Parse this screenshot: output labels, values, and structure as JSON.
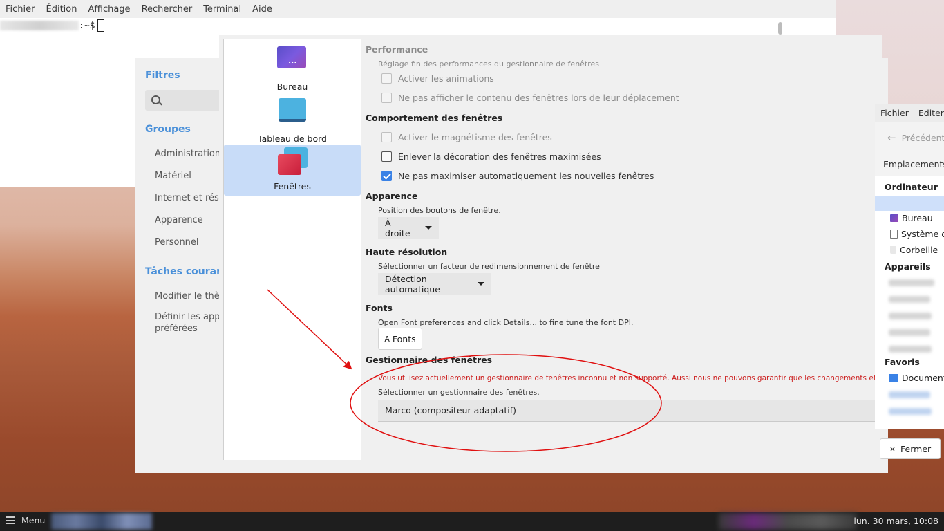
{
  "terminal": {
    "menu": [
      "Fichier",
      "Édition",
      "Affichage",
      "Rechercher",
      "Terminal",
      "Aide"
    ],
    "prompt_suffix": ":~$"
  },
  "control_center": {
    "filters_heading": "Filtres",
    "search_placeholder": "",
    "groups_heading": "Groupes",
    "groups": [
      "Administration",
      "Matériel",
      "Internet et résea",
      "Apparence",
      "Personnel"
    ],
    "tasks_heading": "Tâches courant",
    "tasks": [
      "Modifier le thèm",
      "Définir les applic\npréférées"
    ]
  },
  "appearance": {
    "categories": [
      {
        "label": "Bureau",
        "icon": "desktop-icon"
      },
      {
        "label": "Tableau de bord",
        "icon": "panel-icon"
      },
      {
        "label": "Fenêtres",
        "icon": "windows-icon",
        "selected": true
      }
    ],
    "performance": {
      "heading": "Performance",
      "subtitle": "Réglage fin des performances du gestionnaire de fenêtres",
      "options": [
        {
          "label": "Activer les animations",
          "checked": false,
          "enabled": false
        },
        {
          "label": "Ne pas afficher le contenu des fenêtres lors de leur déplacement",
          "checked": false,
          "enabled": false
        }
      ]
    },
    "behaviour": {
      "heading": "Comportement des fenêtres",
      "options": [
        {
          "label": "Activer le magnétisme des fenêtres",
          "checked": false,
          "enabled": false
        },
        {
          "label": "Enlever la décoration des fenêtres maximisées",
          "checked": false,
          "enabled": true
        },
        {
          "label": "Ne pas maximiser automatiquement les nouvelles fenêtres",
          "checked": true,
          "enabled": true
        }
      ]
    },
    "appearance_section": {
      "heading": "Apparence",
      "subtitle": "Position des boutons de fenêtre.",
      "value": "À droite"
    },
    "hidpi": {
      "heading": "Haute résolution",
      "subtitle": "Sélectionner un facteur de redimensionnement de fenêtre",
      "value": "Détection automatique"
    },
    "fonts": {
      "heading": "Fonts",
      "subtitle": "Open Font preferences and click Details... to fine tune the font DPI.",
      "button": "Fonts",
      "button_icon": "A"
    },
    "wm": {
      "heading": "Gestionnaire des fenêtres",
      "warning": "Vous utilisez actuellement un gestionnaire de fenêtres inconnu et non supporté. Aussi nous ne pouvons garantir que les changements effectués ici so",
      "subtitle": "Sélectionner un gestionnaire des fenêtres.",
      "value": "Marco (compositeur adaptatif)"
    }
  },
  "file_manager": {
    "menu": [
      "Fichier",
      "Editer"
    ],
    "back_label": "Précédent",
    "places_tab": "Emplacements",
    "computer_heading": "Ordinateur",
    "computer_items": [
      "Bureau",
      "Système de",
      "Corbeille"
    ],
    "devices_heading": "Appareils",
    "favorites_heading": "Favoris",
    "favorites_items": [
      "Documents"
    ],
    "close_button": "Fermer"
  },
  "taskbar": {
    "menu_label": "Menu",
    "clock": "lun. 30 mars, 10:08"
  },
  "colors": {
    "accent": "#4a90d9",
    "selection": "#c8dcf8",
    "warning": "#cc2020",
    "annotation": "#e01010"
  }
}
